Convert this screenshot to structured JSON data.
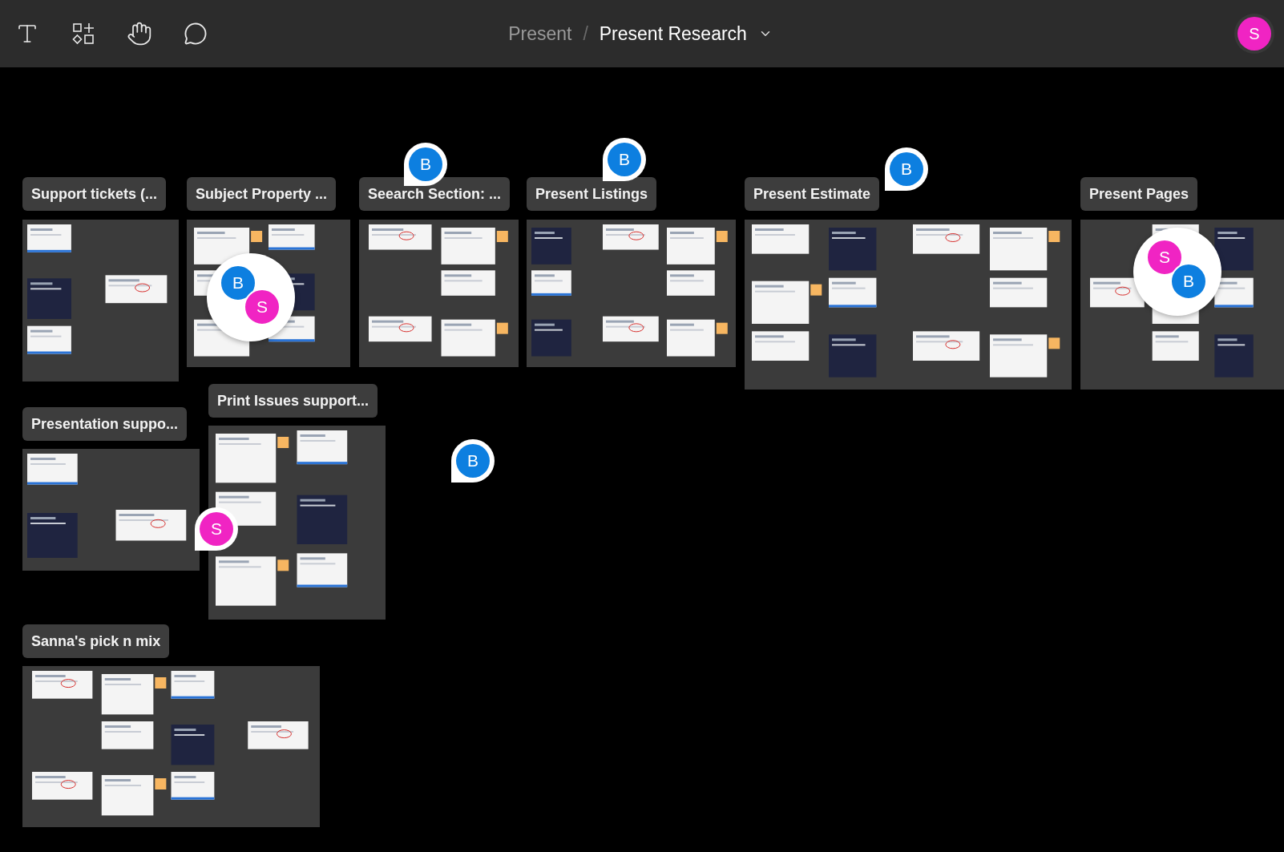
{
  "breadcrumb": {
    "parent": "Present",
    "separator": "/",
    "title": "Present Research"
  },
  "user": {
    "letter": "S",
    "color": "#f024c3"
  },
  "sections": [
    {
      "title": "Support tickets (..."
    },
    {
      "title": "Subject Property ..."
    },
    {
      "title": "Seearch Section: ..."
    },
    {
      "title": "Present Listings"
    },
    {
      "title": "Present Estimate"
    },
    {
      "title": "Present Pages"
    },
    {
      "title": "Presentation suppo..."
    },
    {
      "title": "Print Issues support..."
    },
    {
      "title": "Sanna's pick n mix"
    }
  ],
  "comments": [
    {
      "avatars": [
        {
          "letter": "B",
          "color": "#0d7fe0"
        }
      ]
    },
    {
      "avatars": [
        {
          "letter": "B",
          "color": "#0d7fe0"
        }
      ]
    },
    {
      "avatars": [
        {
          "letter": "B",
          "color": "#0d7fe0"
        }
      ]
    },
    {
      "avatars": [
        {
          "letter": "B",
          "color": "#0d7fe0"
        },
        {
          "letter": "S",
          "color": "#f024c3"
        }
      ]
    },
    {
      "avatars": [
        {
          "letter": "S",
          "color": "#f024c3"
        },
        {
          "letter": "B",
          "color": "#0d7fe0"
        }
      ]
    },
    {
      "avatars": [
        {
          "letter": "B",
          "color": "#0d7fe0"
        }
      ]
    },
    {
      "avatars": [
        {
          "letter": "S",
          "color": "#f024c3"
        }
      ]
    }
  ]
}
